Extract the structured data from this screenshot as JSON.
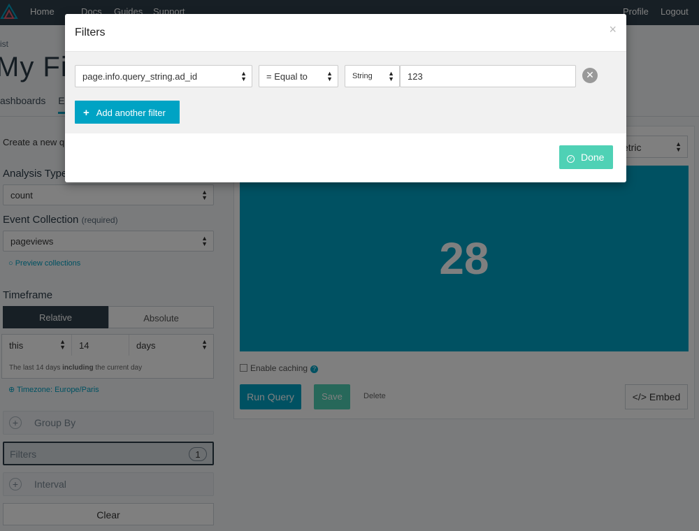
{
  "nav": {
    "links": [
      "Home",
      "Docs",
      "Guides",
      "Support"
    ],
    "right_links": [
      "Profile",
      "Logout"
    ]
  },
  "page": {
    "breadcrumb": "ist",
    "title": "My Fir",
    "tabs": [
      "ashboards",
      "E"
    ]
  },
  "explorer": {
    "create_text": "Create a new q",
    "analysis_type_label": "Analysis Type",
    "analysis_type_value": "count",
    "event_collection_label": "Event Collection",
    "event_collection_required": "(required)",
    "event_collection_value": "pageviews",
    "preview_collections": "Preview collections",
    "timeframe_label": "Timeframe",
    "timeframe_relative": "Relative",
    "timeframe_absolute": "Absolute",
    "timeframe_this": "this",
    "timeframe_amount": "14",
    "timeframe_unit": "days",
    "timeframe_hint_pre": "The last 14 days",
    "timeframe_hint_bold": "including",
    "timeframe_hint_post": "the current day",
    "timezone": "Timezone: Europe/Paris",
    "group_by": "Group By",
    "filters": "Filters",
    "filters_count": "1",
    "interval": "Interval",
    "clear": "Clear"
  },
  "results": {
    "viz_select": "etric",
    "metric_value": "28",
    "enable_caching": "Enable caching",
    "run_query": "Run Query",
    "save": "Save",
    "delete": "Delete",
    "embed": "</> Embed"
  },
  "modal": {
    "title": "Filters",
    "close": "×",
    "filter": {
      "property": "page.info.query_string.ad_id",
      "operator": "= Equal to",
      "type": "String",
      "value": "123"
    },
    "add_filter": "Add another filter",
    "done": "Done"
  },
  "colors": {
    "accent": "#00a3c4",
    "success": "#4fd1b5",
    "navbar": "#2f3f4b"
  }
}
